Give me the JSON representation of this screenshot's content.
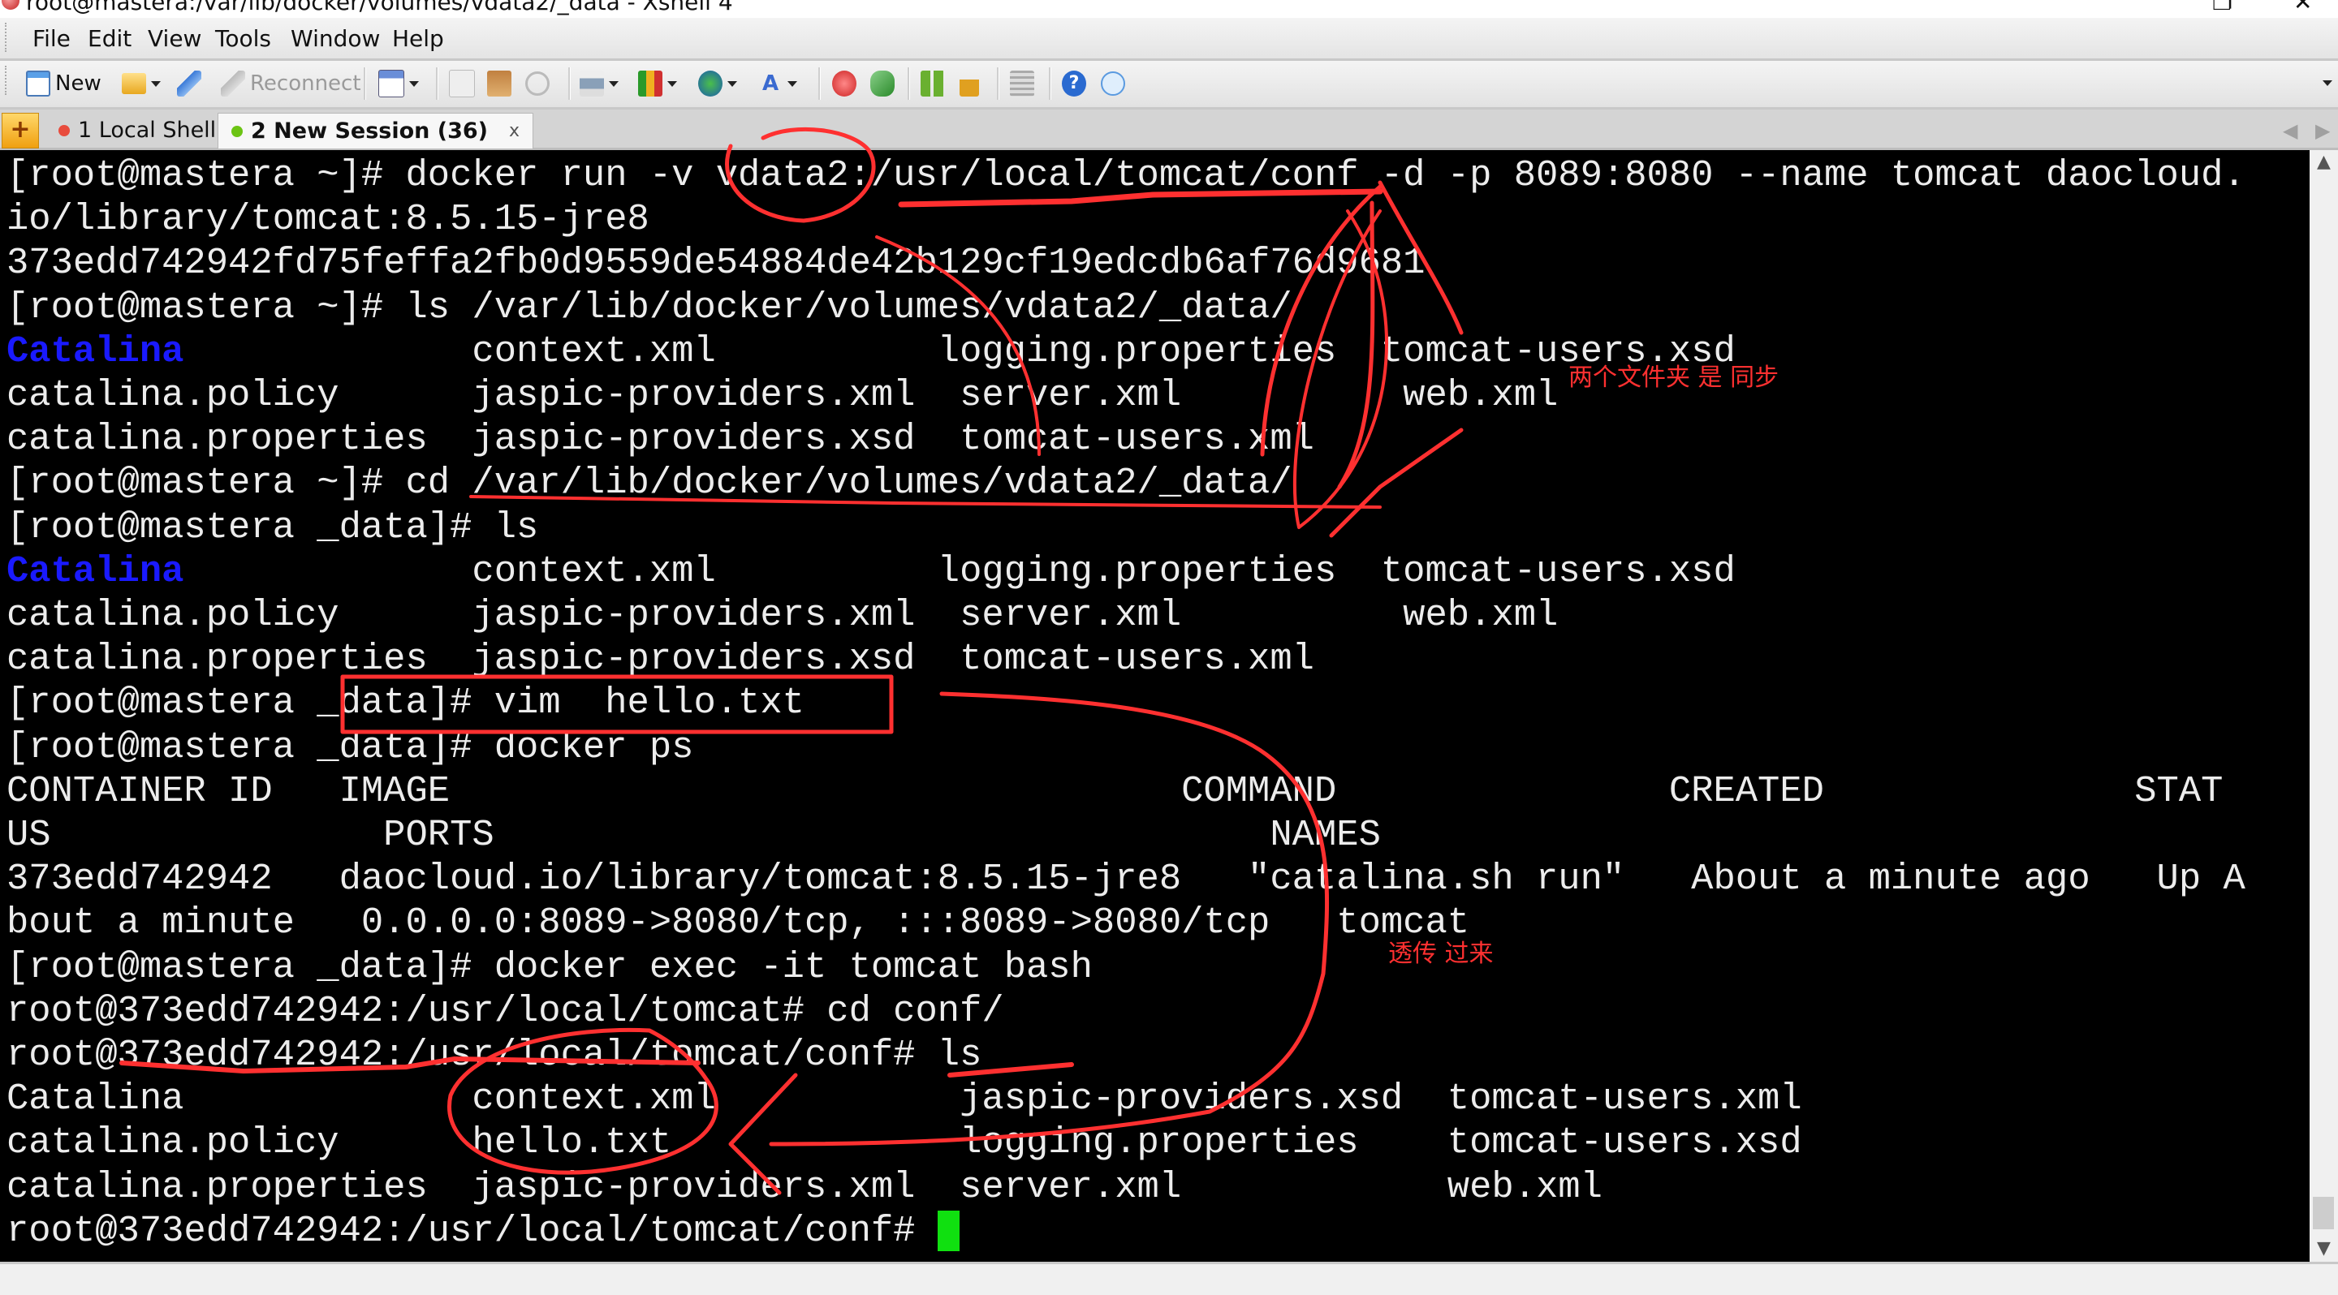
{
  "window": {
    "title": "root@mastera:/var/lib/docker/volumes/vdata2/_data - Xshell 4",
    "restore_icon": "restore-icon",
    "close_icon": "close-icon"
  },
  "menu": [
    "File",
    "Edit",
    "View",
    "Tools",
    "Window",
    "Help"
  ],
  "toolbar": {
    "new_label": "New",
    "reconnect_label": "Reconnect",
    "icons": [
      "new-session-icon",
      "open-folder-icon",
      "connect-icon",
      "reconnect-icon",
      "properties-icon",
      "copy-icon",
      "paste-icon",
      "find-icon",
      "print-icon",
      "transfer-icon",
      "globe-icon",
      "font-icon",
      "xftp-icon",
      "xmanager-icon",
      "layout-icon",
      "lock-icon",
      "keyboard-icon",
      "help-icon",
      "chat-icon"
    ]
  },
  "tabs": [
    {
      "label": "1 Local Shell",
      "status_color": "#e84c3d",
      "active": false
    },
    {
      "label": "2 New Session (36)",
      "status_color": "#6cc414",
      "active": true,
      "close": "x"
    }
  ],
  "terminal": {
    "lines": [
      [
        {
          "t": "[root@mastera ~]# docker run -v vdata2:/usr/local/tomcat/conf -d -p 8089:8080 --name tomcat daocloud."
        }
      ],
      [
        {
          "t": "io/library/tomcat:8.5.15-jre8"
        }
      ],
      [
        {
          "t": "373edd742942fd75feffa2fb0d9559de54884de42b129cf19edcdb6af76d9681"
        }
      ],
      [
        {
          "t": "[root@mastera ~]# ls /var/lib/docker/volumes/vdata2/_data/"
        }
      ],
      [
        {
          "t": "Catalina",
          "c": "dir"
        },
        {
          "t": "             context.xml          logging.properties  tomcat-users.xsd"
        }
      ],
      [
        {
          "t": "catalina.policy      jaspic-providers.xml  server.xml          web.xml"
        }
      ],
      [
        {
          "t": "catalina.properties  jaspic-providers.xsd  tomcat-users.xml"
        }
      ],
      [
        {
          "t": "[root@mastera ~]# cd /var/lib/docker/volumes/vdata2/_data/"
        }
      ],
      [
        {
          "t": "[root@mastera _data]# ls"
        }
      ],
      [
        {
          "t": "Catalina",
          "c": "dir"
        },
        {
          "t": "             context.xml          logging.properties  tomcat-users.xsd"
        }
      ],
      [
        {
          "t": "catalina.policy      jaspic-providers.xml  server.xml          web.xml"
        }
      ],
      [
        {
          "t": "catalina.properties  jaspic-providers.xsd  tomcat-users.xml"
        }
      ],
      [
        {
          "t": "[root@mastera _data]# vim  hello.txt"
        }
      ],
      [
        {
          "t": "[root@mastera _data]# docker ps"
        }
      ],
      [
        {
          "t": "CONTAINER ID   IMAGE                                 COMMAND               CREATED              STAT"
        }
      ],
      [
        {
          "t": "US               PORTS                                   NAMES"
        }
      ],
      [
        {
          "t": "373edd742942   daocloud.io/library/tomcat:8.5.15-jre8   \"catalina.sh run\"   About a minute ago   Up A"
        }
      ],
      [
        {
          "t": "bout a minute   0.0.0.0:8089->8080/tcp, :::8089->8080/tcp   tomcat"
        }
      ],
      [
        {
          "t": "[root@mastera _data]# docker exec -it tomcat bash"
        }
      ],
      [
        {
          "t": "root@373edd742942:/usr/local/tomcat# cd conf/"
        }
      ],
      [
        {
          "t": "root@373edd742942:/usr/local/tomcat/conf# ls"
        }
      ],
      [
        {
          "t": "Catalina             context.xml           jaspic-providers.xsd  tomcat-users.xml"
        }
      ],
      [
        {
          "t": "catalina.policy      hello.txt             logging.properties    tomcat-users.xsd"
        }
      ],
      [
        {
          "t": "catalina.properties  jaspic-providers.xml  server.xml            web.xml"
        }
      ],
      [
        {
          "t": "root@373edd742942:/usr/local/tomcat/conf# "
        },
        {
          "cursor": true
        }
      ]
    ]
  },
  "annotations": {
    "note_sync": "两个文件夹 是 同步",
    "note_passthrough": "透传 过来",
    "color": "#ff3030"
  }
}
